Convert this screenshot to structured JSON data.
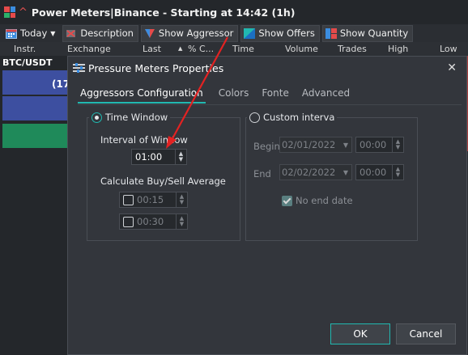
{
  "window": {
    "title": "Power Meters|Binance - Starting at 14:42 (1h)"
  },
  "toolbar": {
    "period": "Today",
    "description": "Description",
    "show_aggressor": "Show Aggressor",
    "show_offers": "Show Offers",
    "show_quantity": "Show Quantity"
  },
  "columns": [
    "Instr.",
    "Exchange",
    "Last",
    "% C...",
    "Time",
    "Volume",
    "Trades",
    "High",
    "Low"
  ],
  "instrument": {
    "symbol": "BTC/USDT",
    "bar_label": "(17"
  },
  "colors": {
    "accent": "#21b8b0",
    "bar_blue": "#3d4fa0",
    "bar_green": "#1f8a5a",
    "arrow": "#e32222"
  },
  "dialog": {
    "title": "Pressure Meters Properties",
    "tabs": [
      "Aggressors Configuration",
      "Colors",
      "Fonte",
      "Advanced"
    ],
    "time_window": {
      "label": "Time Window",
      "interval_label": "Interval of Window",
      "interval_value": "01:00",
      "calc_label": "Calculate Buy/Sell Average",
      "avg1": "00:15",
      "avg2": "00:30"
    },
    "custom_interval": {
      "label": "Custom interva",
      "begin_label": "Begin",
      "begin_date": "02/01/2022",
      "begin_time": "00:00",
      "end_label": "End",
      "end_date": "02/02/2022",
      "end_time": "00:00",
      "no_end_date": "No end date"
    },
    "ok": "OK",
    "cancel": "Cancel"
  }
}
